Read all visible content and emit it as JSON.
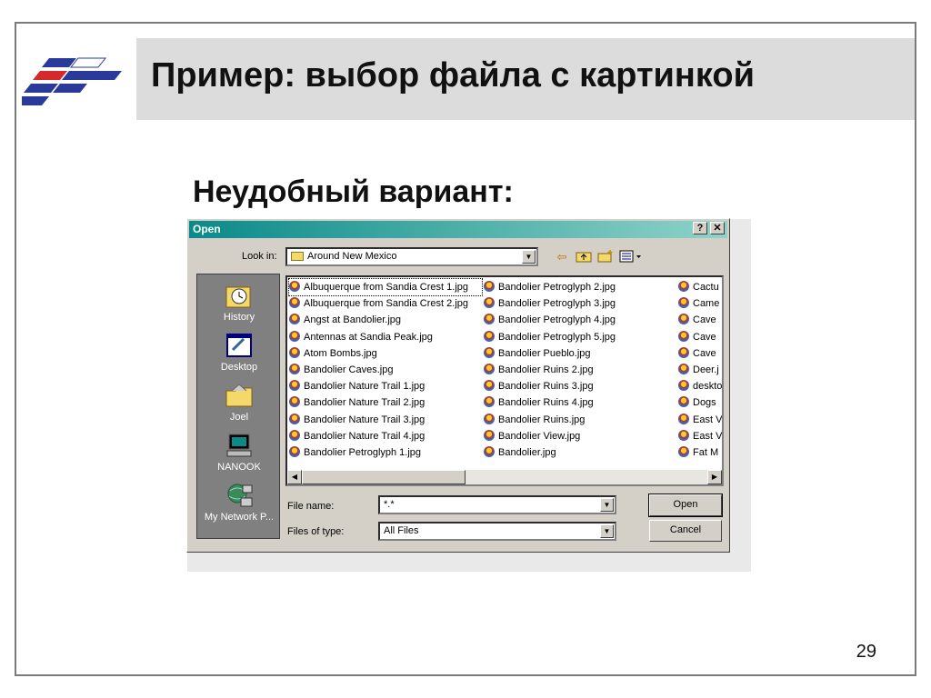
{
  "slide": {
    "title": "Пример: выбор файла с картинкой",
    "subtitle": "Неудобный вариант:",
    "page_number": "29"
  },
  "dialog": {
    "title": "Open",
    "help_button": "?",
    "close_button": "✕",
    "look_in_label": "Look in:",
    "look_in_value": "Around New Mexico",
    "places": [
      {
        "label": "History",
        "icon": "history-icon"
      },
      {
        "label": "Desktop",
        "icon": "desktop-icon"
      },
      {
        "label": "Joel",
        "icon": "folder-icon"
      },
      {
        "label": "NANOOK",
        "icon": "computer-icon"
      },
      {
        "label": "My Network P...",
        "icon": "network-icon"
      }
    ],
    "files_col1": [
      "Albuquerque from Sandia Crest 1.jpg",
      "Albuquerque from Sandia Crest 2.jpg",
      "Angst at Bandolier.jpg",
      "Antennas at Sandia Peak.jpg",
      "Atom Bombs.jpg",
      "Bandolier Caves.jpg",
      "Bandolier Nature Trail 1.jpg",
      "Bandolier Nature Trail 2.jpg",
      "Bandolier Nature Trail 3.jpg",
      "Bandolier Nature Trail 4.jpg",
      "Bandolier Petroglyph 1.jpg"
    ],
    "files_col2": [
      "Bandolier Petroglyph 2.jpg",
      "Bandolier Petroglyph 3.jpg",
      "Bandolier Petroglyph 4.jpg",
      "Bandolier Petroglyph 5.jpg",
      "Bandolier Pueblo.jpg",
      "Bandolier Ruins 2.jpg",
      "Bandolier Ruins 3.jpg",
      "Bandolier Ruins 4.jpg",
      "Bandolier Ruins.jpg",
      "Bandolier View.jpg",
      "Bandolier.jpg"
    ],
    "files_col3": [
      "Cactu",
      "Came",
      "Cave",
      "Cave",
      "Cave",
      "Deer.j",
      "deskto",
      "Dogs",
      "East V",
      "East V",
      "Fat M"
    ],
    "file_name_label": "File name:",
    "file_name_value": "*.*",
    "files_of_type_label": "Files of type:",
    "files_of_type_value": "All Files",
    "open_button": "Open",
    "cancel_button": "Cancel"
  }
}
